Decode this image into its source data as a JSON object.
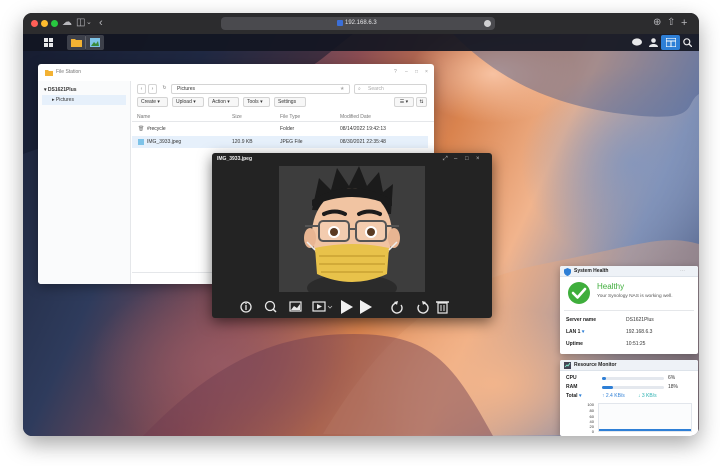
{
  "browser": {
    "url": "192.168.6.3",
    "tab_icons": [
      "sidebar-icon",
      "back-icon"
    ],
    "right_icons": [
      "download-icon",
      "share-icon",
      "new-tab-icon",
      "tab-overview-icon"
    ]
  },
  "taskbar": {
    "left": [
      "main-menu-icon",
      "file-station-icon",
      "image-viewer-icon"
    ],
    "right": [
      "messages-icon",
      "user-icon",
      "widgets-icon",
      "search-icon"
    ]
  },
  "file_station": {
    "title": "File Station",
    "tree_root": "DS1621Plus",
    "tree_child": "Pictures",
    "path": "Pictures",
    "search_placeholder": "Search",
    "toolbar": [
      "Create",
      "Upload",
      "Action",
      "Tools",
      "Settings"
    ],
    "columns": [
      "Name",
      "Size",
      "File Type",
      "Modified Date"
    ],
    "rows": [
      {
        "name": "#recycle",
        "size": "",
        "type": "Folder",
        "date": "08/14/2022 19:42:13"
      },
      {
        "name": "IMG_3933.jpeg",
        "size": "120.9 KB",
        "type": "JPEG File",
        "date": "08/30/2021 22:35:48"
      }
    ]
  },
  "viewer": {
    "title": "IMG_3933.jpeg",
    "controls": [
      "info-icon",
      "zoom-icon",
      "image-icon",
      "slideshow-icon",
      "previous-icon",
      "next-icon",
      "rotate-left-icon",
      "rotate-right-icon",
      "delete-icon"
    ]
  },
  "system_health": {
    "title": "System Health",
    "status": "Healthy",
    "message": "Your Synology NAS is working well.",
    "rows": [
      {
        "label": "Server name",
        "value": "DS1621Plus"
      },
      {
        "label": "LAN 1",
        "value": "192.168.6.3"
      },
      {
        "label": "Uptime",
        "value": "10:51:25"
      }
    ]
  },
  "resource_monitor": {
    "title": "Resource Monitor",
    "cpu_label": "CPU",
    "cpu_value": "6%",
    "cpu_fraction": 0.06,
    "ram_label": "RAM",
    "ram_value": "18%",
    "ram_fraction": 0.18,
    "total_label": "Total",
    "upload": "2.4 KB/s",
    "download": "3 KB/s",
    "chart_ticks": [
      "100",
      "80",
      "60",
      "40",
      "20",
      "0"
    ]
  },
  "colors": {
    "accent": "#2e7fd6",
    "healthy": "#3fae3c",
    "viewer_bg": "#232323"
  }
}
